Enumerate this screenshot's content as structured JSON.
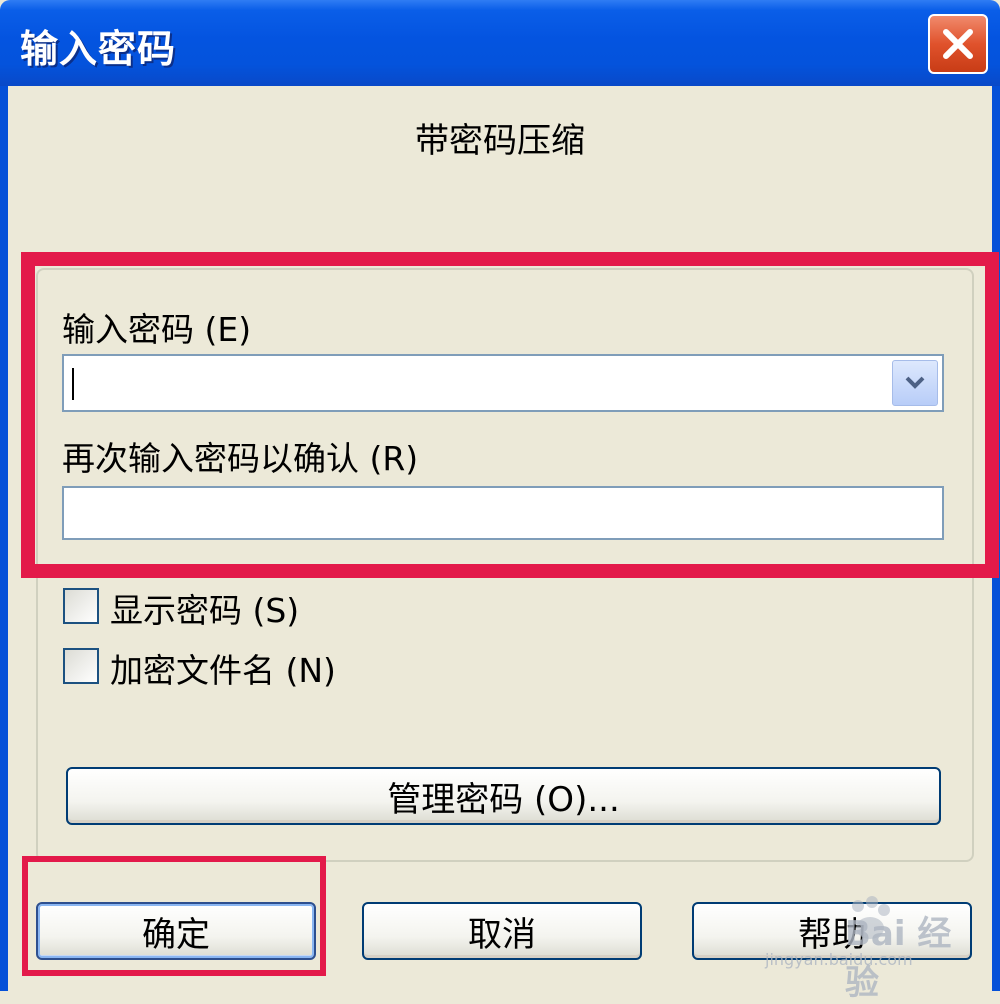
{
  "window": {
    "title": "输入密码",
    "subtitle": "带密码压缩"
  },
  "fields": {
    "password_label": "输入密码 (E)",
    "password_value": "",
    "confirm_label": "再次输入密码以确认 (R)",
    "confirm_value": ""
  },
  "options": {
    "show_password_label": "显示密码 (S)",
    "show_password_checked": false,
    "encrypt_filenames_label": "加密文件名 (N)",
    "encrypt_filenames_checked": false
  },
  "buttons": {
    "manage_label": "管理密码 (O)...",
    "ok_label": "确定",
    "cancel_label": "取消",
    "help_label": "帮助"
  },
  "watermark": {
    "brand": "Bai 经验",
    "url": "jingyan.baidu.com"
  },
  "colors": {
    "titlebar": "#0454e0",
    "highlight": "#e31a4a",
    "dialog_bg": "#ece9d8"
  }
}
